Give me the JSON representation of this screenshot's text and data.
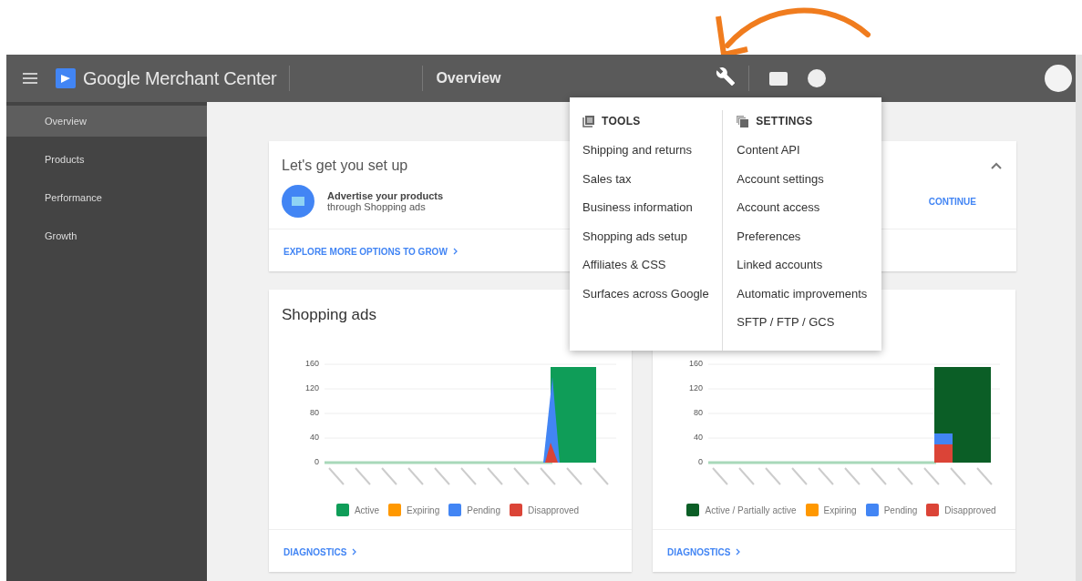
{
  "header": {
    "app_name": "Google Merchant Center",
    "page_title": "Overview"
  },
  "sidebar": {
    "items": [
      {
        "label": "Overview",
        "selected": true
      },
      {
        "label": "Products",
        "selected": false
      },
      {
        "label": "Performance",
        "selected": false
      },
      {
        "label": "Growth",
        "selected": false
      }
    ]
  },
  "setup_card": {
    "title": "Let's get you set up",
    "task_title": "Advertise your products",
    "task_subtitle": "through Shopping ads",
    "action": "CONTINUE",
    "link": "EXPLORE MORE OPTIONS TO GROW"
  },
  "chart_cards": [
    {
      "title": "Shopping ads",
      "kind": "spike",
      "yticks": [
        "160",
        "120",
        "80",
        "40",
        "0"
      ],
      "legend": [
        {
          "label": "Active",
          "color": "#0f9d58"
        },
        {
          "label": "Expiring",
          "color": "#ff9800"
        },
        {
          "label": "Pending",
          "color": "#4285f4"
        },
        {
          "label": "Disapproved",
          "color": "#db4437"
        }
      ],
      "link": "DIAGNOSTICS"
    },
    {
      "kind": "block",
      "yticks": [
        "160",
        "120",
        "80",
        "40",
        "0"
      ],
      "legend": [
        {
          "label": "Active / Partially active",
          "color": "#0b5e26"
        },
        {
          "label": "Expiring",
          "color": "#ff9800"
        },
        {
          "label": "Pending",
          "color": "#4285f4"
        },
        {
          "label": "Disapproved",
          "color": "#db4437"
        }
      ],
      "link": "DIAGNOSTICS"
    }
  ],
  "tools_menu": {
    "sections": [
      {
        "title": "TOOLS",
        "kind": "tools",
        "items": [
          "Shipping and returns",
          "Sales tax",
          "Business information",
          "Shopping ads setup",
          "Affiliates & CSS",
          "Surfaces across Google"
        ]
      },
      {
        "title": "SETTINGS",
        "kind": "settings",
        "items": [
          "Content API",
          "Account settings",
          "Account access",
          "Preferences",
          "Linked accounts",
          "Automatic improvements",
          "SFTP / FTP / GCS"
        ]
      }
    ]
  }
}
